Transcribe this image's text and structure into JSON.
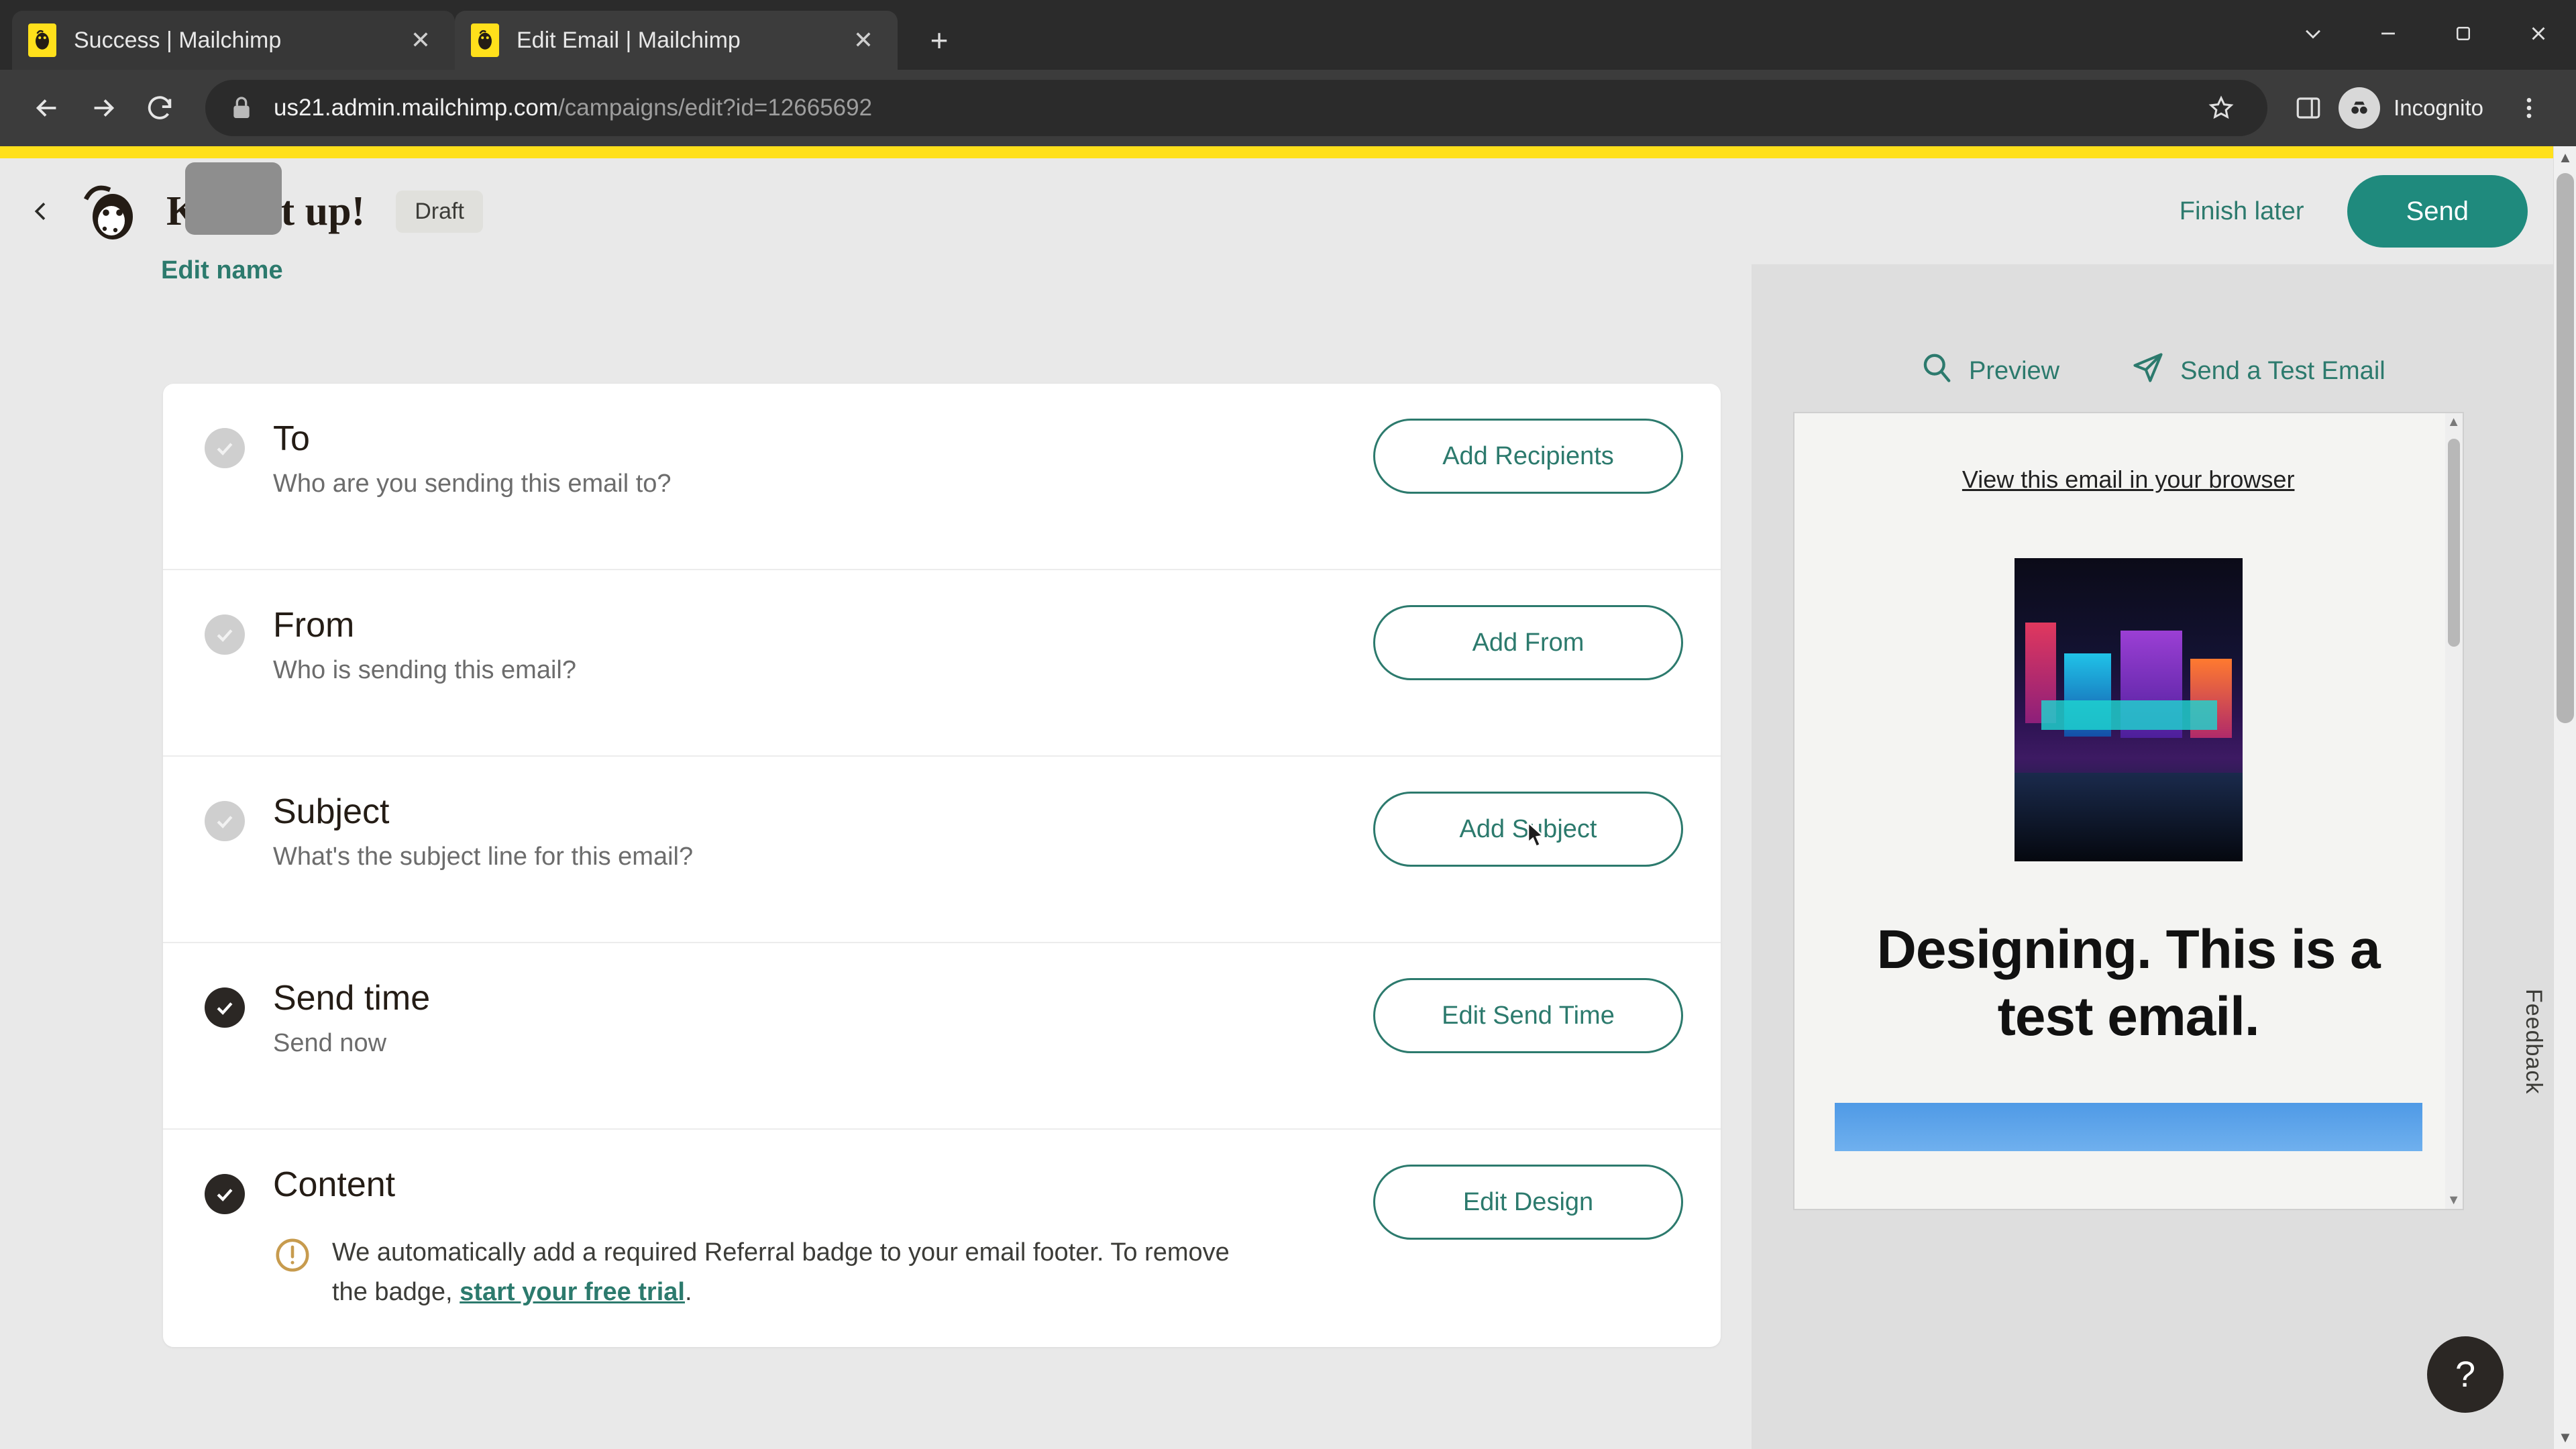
{
  "browser": {
    "tabs": [
      {
        "title": "Success | Mailchimp",
        "active": false
      },
      {
        "title": "Edit Email | Mailchimp",
        "active": true
      }
    ],
    "new_tab_label": "+",
    "close_label": "✕",
    "url_host": "us21.admin.mailchimp.com",
    "url_path": "/campaigns/edit?id=12665692",
    "profile_label": "Incognito"
  },
  "app": {
    "title": "Keep it up!",
    "status_badge": "Draft",
    "edit_name_link": "Edit name",
    "finish_later": "Finish later",
    "send_button": "Send"
  },
  "checklist": [
    {
      "title": "To",
      "subtitle": "Who are you sending this email to?",
      "action": "Add Recipients",
      "complete": false
    },
    {
      "title": "From",
      "subtitle": "Who is sending this email?",
      "action": "Add From",
      "complete": false
    },
    {
      "title": "Subject",
      "subtitle": "What's the subject line for this email?",
      "action": "Add Subject",
      "complete": false
    },
    {
      "title": "Send time",
      "subtitle": "Send now",
      "action": "Edit Send Time",
      "complete": true
    },
    {
      "title": "Content",
      "subtitle": "",
      "action": "Edit Design",
      "complete": true,
      "warning_text_before": "We automatically add a required Referral badge to your email footer. To remove the badge, ",
      "warning_link": "start your free trial",
      "warning_text_after": "."
    }
  ],
  "preview": {
    "preview_label": "Preview",
    "test_email_label": "Send a Test Email",
    "email": {
      "view_in_browser": "View this email in your browser",
      "headline": "Designing. This is a test email."
    }
  },
  "feedback_label": "Feedback",
  "help_label": "?",
  "colors": {
    "brand_yellow": "#FFE01B",
    "teal": "#2C7A6D",
    "send_teal": "#1F8A7D",
    "warning_amber": "#C79B4E"
  }
}
